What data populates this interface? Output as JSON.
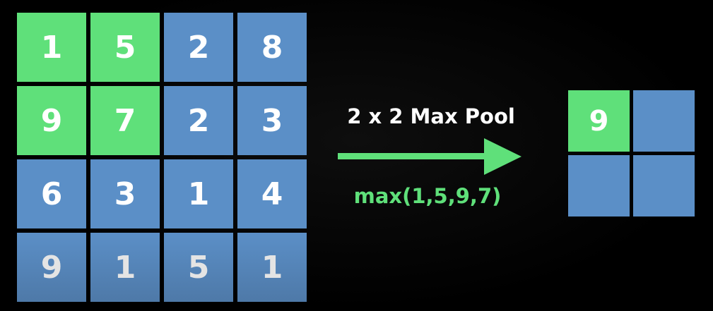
{
  "input_grid": {
    "rows": [
      [
        "1",
        "5",
        "2",
        "8"
      ],
      [
        "9",
        "7",
        "2",
        "3"
      ],
      [
        "6",
        "3",
        "1",
        "4"
      ],
      [
        "9",
        "1",
        "5",
        "1"
      ]
    ],
    "highlighted": [
      [
        0,
        0
      ],
      [
        0,
        1
      ],
      [
        1,
        0
      ],
      [
        1,
        1
      ]
    ]
  },
  "operation": {
    "label": "2 x 2 Max Pool",
    "formula": "max(1,5,9,7)"
  },
  "output_grid": {
    "rows": [
      [
        "9",
        ""
      ],
      [
        "",
        ""
      ]
    ],
    "highlighted": [
      [
        0,
        0
      ]
    ]
  },
  "colors": {
    "highlight": "#5fe07a",
    "cell": "#5b8fc7",
    "background": "#000000",
    "text": "#ffffff"
  }
}
